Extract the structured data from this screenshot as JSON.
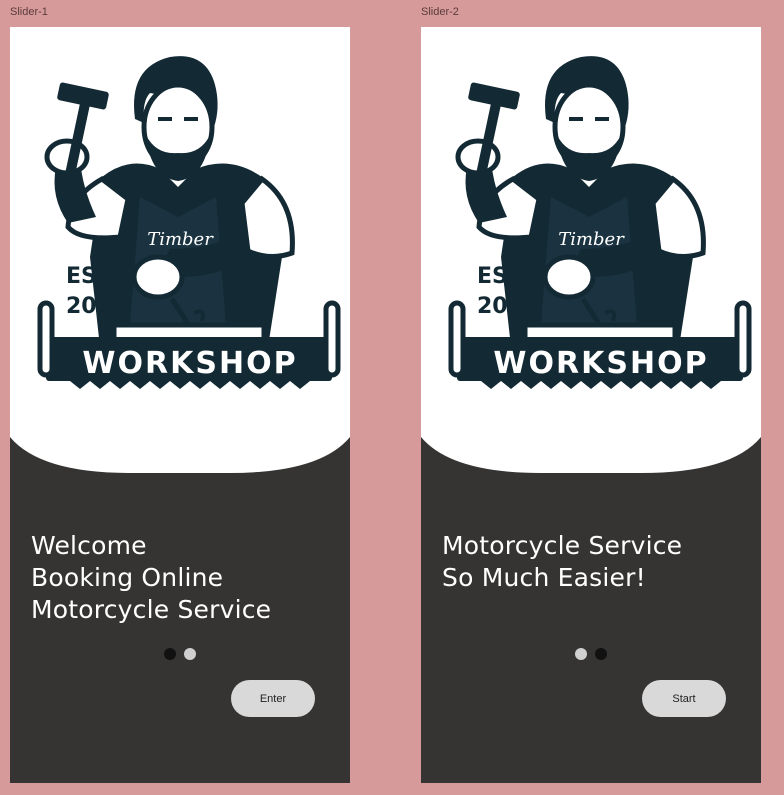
{
  "frames": [
    {
      "label": "Slider-1",
      "headline": [
        "Welcome",
        "Booking Online",
        "Motorcycle Service"
      ],
      "button": "Enter",
      "active_dot": 1
    },
    {
      "label": "Slider-2",
      "headline": [
        "Motorcycle Service",
        "So Much Easier!"
      ],
      "button": "Start",
      "active_dot": 2
    }
  ],
  "logo": {
    "script": "Timber",
    "estd_line1": "ESTD",
    "estd_line2": "2021",
    "banner": "WORKSHOP"
  },
  "colors": {
    "canvas": "#d79a9a",
    "panel": "#353433",
    "hero": "#ffffff",
    "ink": "#132a35",
    "dot_active": "#111111",
    "dot_inactive": "#d0d0d0",
    "button": "#d9d9d9"
  }
}
